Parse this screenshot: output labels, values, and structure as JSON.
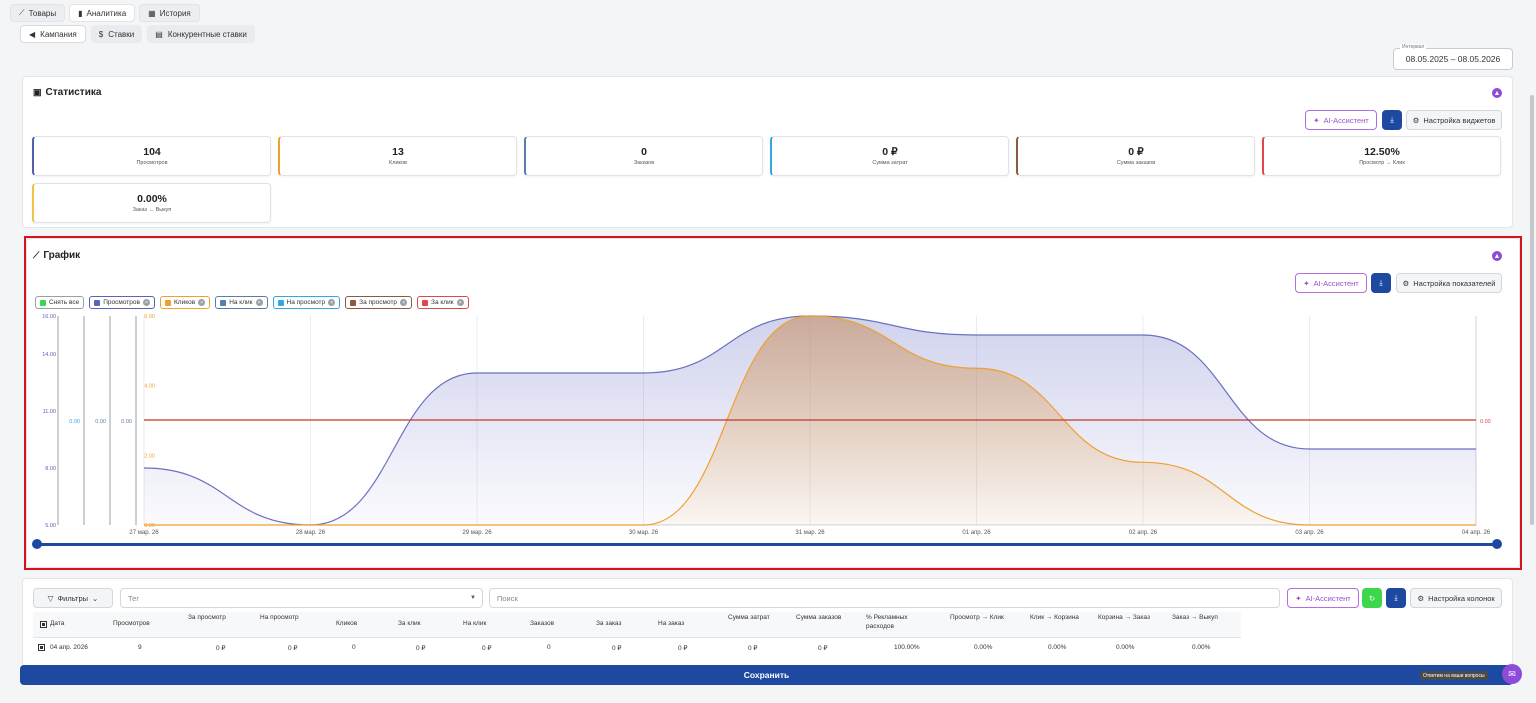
{
  "tabs": [
    {
      "label": "Товары",
      "icon": "chart-line-icon"
    },
    {
      "label": "Аналитика",
      "icon": "bar-chart-icon"
    },
    {
      "label": "История",
      "icon": "calendar-icon"
    }
  ],
  "subtabs": [
    {
      "label": "Кампания",
      "icon": "megaphone-icon"
    },
    {
      "label": "Ставки",
      "icon": "coins-icon"
    },
    {
      "label": "Конкурентные ставки",
      "icon": "compare-icon"
    }
  ],
  "date_range": {
    "label": "Интервал",
    "value": "08.05.2025 – 08.05.2026"
  },
  "stats_card": {
    "title": "Статистика",
    "ai_label": "AI-Ассистент",
    "settings_label": "Настройка виджетов",
    "items": [
      {
        "value": "104",
        "label": "Просмотров",
        "color": "#4f5fae"
      },
      {
        "value": "13",
        "label": "Кликов",
        "color": "#f0a030"
      },
      {
        "value": "0",
        "label": "Заказов",
        "color": "#5a7db0"
      },
      {
        "value": "0 ₽",
        "label": "Сумма затрат",
        "color": "#33a7e0"
      },
      {
        "value": "0 ₽",
        "label": "Сумма заказов",
        "color": "#8a5a44"
      },
      {
        "value": "12.50%",
        "label": "Просмотр → Клик",
        "color": "#e0474c"
      },
      {
        "value": "0.00%",
        "label": "Заказ → Выкуп",
        "color": "#f2c14a"
      }
    ]
  },
  "graph_card": {
    "title": "График",
    "ai_label": "AI-Ассистент",
    "settings_label": "Настройка показателей",
    "legend": [
      {
        "label": "Снять все",
        "color": "#3ed64a",
        "border": "#9aa0a8",
        "removable": false
      },
      {
        "label": "Просмотров",
        "color": "#5b62b8",
        "border": "#5b62b8",
        "removable": true
      },
      {
        "label": "Кликов",
        "color": "#f0a030",
        "border": "#f0a030",
        "removable": true
      },
      {
        "label": "На клик",
        "color": "#5a7db0",
        "border": "#5a7db0",
        "removable": true
      },
      {
        "label": "На просмотр",
        "color": "#33a7e0",
        "border": "#33a7e0",
        "removable": true
      },
      {
        "label": "За просмотр",
        "color": "#8a5a44",
        "border": "#8a5a44",
        "removable": true
      },
      {
        "label": "За клик",
        "color": "#e0474c",
        "border": "#e0474c",
        "removable": true
      }
    ]
  },
  "chart_data": {
    "type": "area",
    "x": [
      "27 мар. 26",
      "28 мар. 26",
      "29 мар. 26",
      "30 мар. 26",
      "31 мар. 26",
      "01 апр. 26",
      "02 апр. 26",
      "03 апр. 26",
      "04 апр. 26"
    ],
    "series": [
      {
        "name": "Просмотров",
        "color": "#6a70c2",
        "values": [
          8,
          5,
          13,
          13,
          16,
          15,
          15,
          9,
          9
        ]
      },
      {
        "name": "Кликов",
        "color": "#f0a030",
        "values": [
          0,
          0,
          0,
          0,
          6,
          4.5,
          1.8,
          0,
          0
        ]
      },
      {
        "name": "За клик",
        "color": "#c0392b",
        "values": [
          0,
          0,
          0,
          0,
          0,
          0,
          0,
          0,
          0
        ]
      }
    ],
    "left_axis_views": {
      "ticks": [
        "16.00",
        "14.00",
        "11.00",
        "8.00",
        "5.00"
      ],
      "ylim": [
        5,
        16
      ]
    },
    "left_axis_clicks": {
      "ticks": [
        "6.00",
        "4.00",
        "2.00",
        "0.00"
      ],
      "ylim": [
        0,
        6
      ]
    },
    "mini_axes_label": "0.00",
    "right_axis_label": "0.00",
    "grid": true
  },
  "table": {
    "filters_label": "Фильтры",
    "tag_placeholder": "Тег",
    "search_placeholder": "Поиск",
    "ai_label": "AI-Ассистент",
    "settings_label": "Настройка колонок",
    "columns": [
      "Дата",
      "Просмотров",
      "За просмотр",
      "На просмотр",
      "Кликов",
      "За клик",
      "На клик",
      "Заказов",
      "За заказ",
      "На заказ",
      "Сумма затрат",
      "Сумма заказов",
      "% Рекламных расходов",
      "Просмотр → Клик",
      "Клик → Корзина",
      "Корзина → Заказ",
      "Заказ → Выкуп"
    ],
    "rows": [
      [
        "04 апр. 2026",
        "9",
        "0 ₽",
        "0 ₽",
        "0",
        "0 ₽",
        "0 ₽",
        "0",
        "0 ₽",
        "0 ₽",
        "0 ₽",
        "0 ₽",
        "100.00%",
        "0.00%",
        "0.00%",
        "0.00%",
        "0.00%"
      ]
    ]
  },
  "save_label": "Сохранить",
  "help_tooltip": "Ответим на ваши вопросы"
}
